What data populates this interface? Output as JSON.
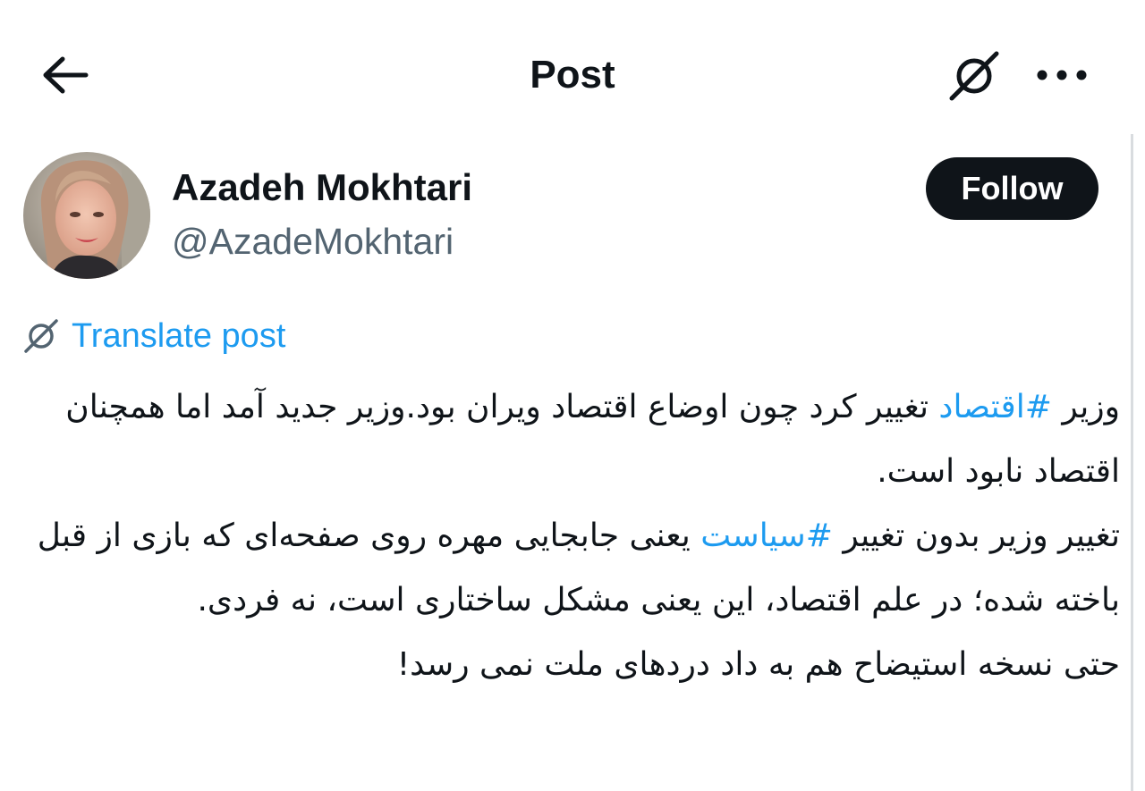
{
  "header": {
    "title": "Post"
  },
  "author": {
    "name": "Azadeh Mokhtari",
    "handle": "@AzadeMokhtari"
  },
  "follow": {
    "label": "Follow"
  },
  "translate": {
    "label": "Translate post"
  },
  "post": {
    "p1_before": "وزیر ",
    "p1_hashtag": "#اقتصاد",
    "p1_after": " تغییر کرد چون اوضاع اقتصاد ویران بود.وزیر جدید آمد اما همچنان اقتصاد نابود است.",
    "p2_before": "تغییر وزیر بدون تغییر ",
    "p2_hashtag": "#سیاست",
    "p2_after": " یعنی جابجایی مهره روی صفحه‌ای که بازی از قبل باخته شده؛ در علم اقتصاد، این یعنی مشکل ساختاری است، نه فردی.",
    "p3": "حتی نسخه استیضاح هم به داد دردهای ملت نمی رسد!"
  },
  "icons": {
    "back": "arrow-left-icon",
    "grok": "grok-icon",
    "more": "more-dots-icon",
    "translate": "grok-translate-icon"
  },
  "colors": {
    "link": "#1d9bf0",
    "text": "#0f1419",
    "secondary": "#536471",
    "follow_bg": "#0f1419"
  }
}
